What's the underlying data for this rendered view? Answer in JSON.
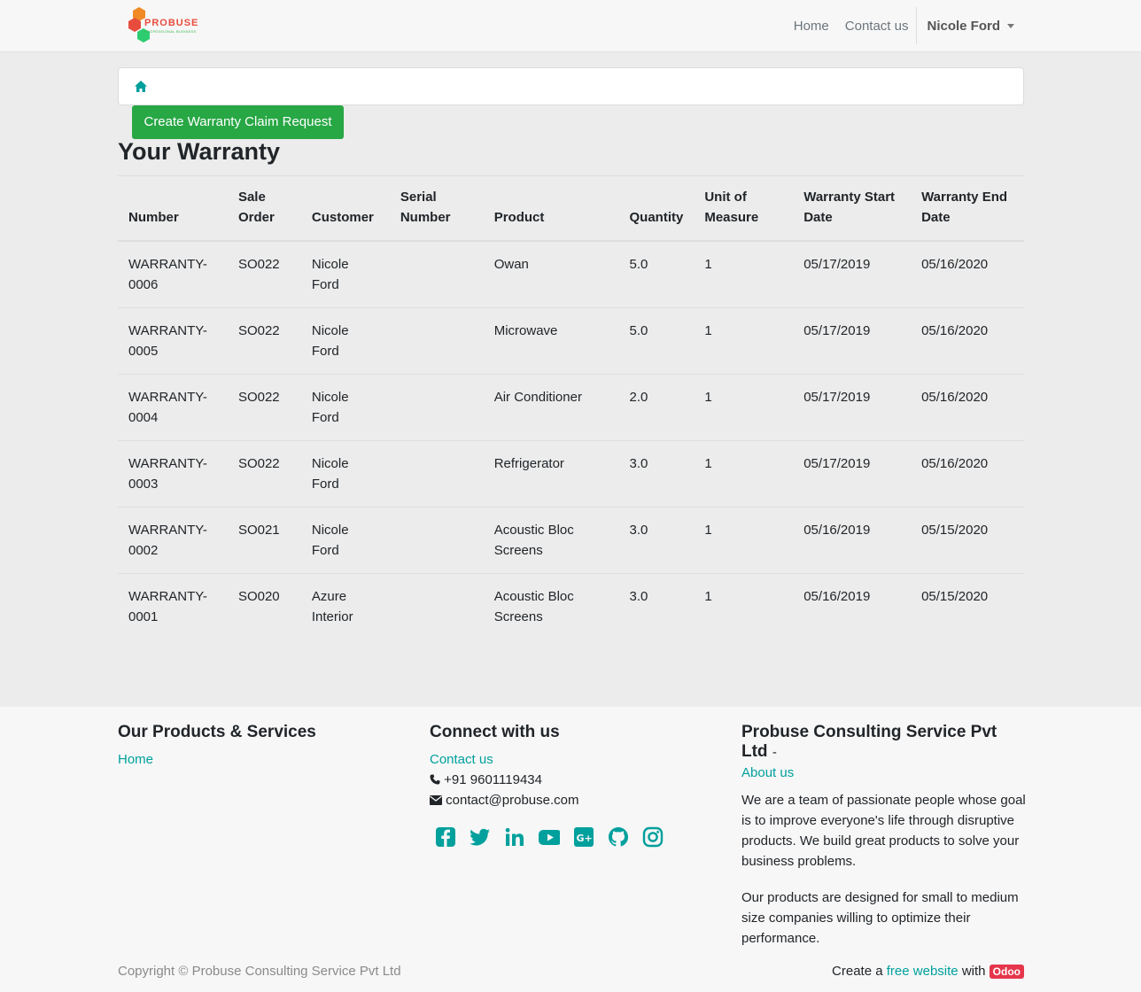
{
  "brand": {
    "logo_text": "PROBUSE",
    "logo_sub": "PROFESSIONAL BUSINESS"
  },
  "nav": {
    "home": "Home",
    "contact": "Contact us",
    "user": "Nicole Ford"
  },
  "page": {
    "create_button": "Create Warranty Claim Request",
    "title": "Your Warranty"
  },
  "table": {
    "columns": [
      "Number",
      "Sale Order",
      "Customer",
      "Serial Number",
      "Product",
      "Quantity",
      "Unit of Measure",
      "Warranty Start Date",
      "Warranty End Date"
    ],
    "rows": [
      [
        "WARRANTY-0006",
        "SO022",
        "Nicole Ford",
        "",
        "Owan",
        "5.0",
        "1",
        "05/17/2019",
        "05/16/2020"
      ],
      [
        "WARRANTY-0005",
        "SO022",
        "Nicole Ford",
        "",
        "Microwave",
        "5.0",
        "1",
        "05/17/2019",
        "05/16/2020"
      ],
      [
        "WARRANTY-0004",
        "SO022",
        "Nicole Ford",
        "",
        "Air Conditioner",
        "2.0",
        "1",
        "05/17/2019",
        "05/16/2020"
      ],
      [
        "WARRANTY-0003",
        "SO022",
        "Nicole Ford",
        "",
        "Refrigerator",
        "3.0",
        "1",
        "05/17/2019",
        "05/16/2020"
      ],
      [
        "WARRANTY-0002",
        "SO021",
        "Nicole Ford",
        "",
        "Acoustic Bloc Screens",
        "3.0",
        "1",
        "05/16/2019",
        "05/15/2020"
      ],
      [
        "WARRANTY-0001",
        "SO020",
        "Azure Interior",
        "",
        "Acoustic Bloc Screens",
        "3.0",
        "1",
        "05/16/2019",
        "05/15/2020"
      ]
    ]
  },
  "footer": {
    "products_title": "Our Products & Services",
    "products_home": "Home",
    "connect_title": "Connect with us",
    "connect_contact": "Contact us",
    "phone": "+91 9601119434",
    "email": "contact@probuse.com",
    "social_icons": [
      "facebook-icon",
      "twitter-icon",
      "linkedin-icon",
      "youtube-icon",
      "google-plus-icon",
      "github-icon",
      "instagram-icon"
    ],
    "company_title": "Probuse Consulting Service Pvt Ltd",
    "company_dash": "-",
    "about_link": "About us",
    "about_p1": "We are a team of passionate people whose goal is to improve everyone's life through disruptive products. We build great products to solve your business problems.",
    "about_p2": "Our products are designed for small to medium size companies willing to optimize their performance.",
    "copyright": "Copyright © Probuse Consulting Service Pvt Ltd",
    "credit_prefix": "Create a",
    "credit_link": "free website",
    "credit_with": "with",
    "credit_badge": "Odoo"
  },
  "colors": {
    "accent": "#00a09d",
    "button": "#28a745",
    "badge": "#e5364b"
  }
}
